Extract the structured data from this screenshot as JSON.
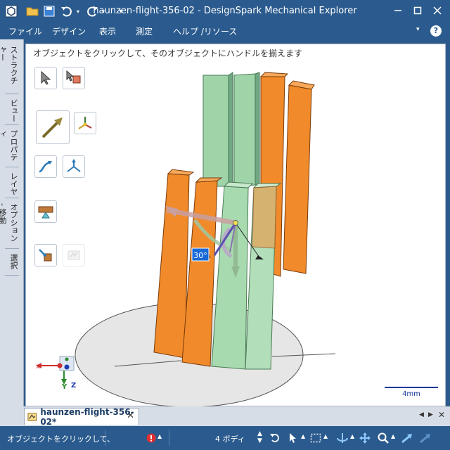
{
  "window": {
    "title": "haunzen-flight-356-02 - DesignSpark Mechanical Explorer"
  },
  "menu": {
    "items": [
      "ファイル",
      "デザイン",
      "表示",
      "測定",
      "ヘルプ /リソース"
    ]
  },
  "left_tabs": [
    "ストラクチャー",
    "ビュー",
    "プロパティ",
    "レイヤ",
    "オプション - 移動",
    "選択"
  ],
  "canvas": {
    "hint": "オブジェクトをクリックして、そのオブジェクトにハンドルを揃えます",
    "angle_label": "30°",
    "scale_label": "4mm"
  },
  "triad": {
    "x": "x",
    "y": "Y",
    "z": "Z"
  },
  "document_tab": {
    "label": "haunzen-flight-356-02*"
  },
  "status": {
    "message": "オブジェクトをクリックして、",
    "selection_count": "4 ボディ"
  },
  "colors": {
    "title_bar": "#2b5b8e",
    "orange": "#f08a2a",
    "green": "#9fd4a9"
  }
}
